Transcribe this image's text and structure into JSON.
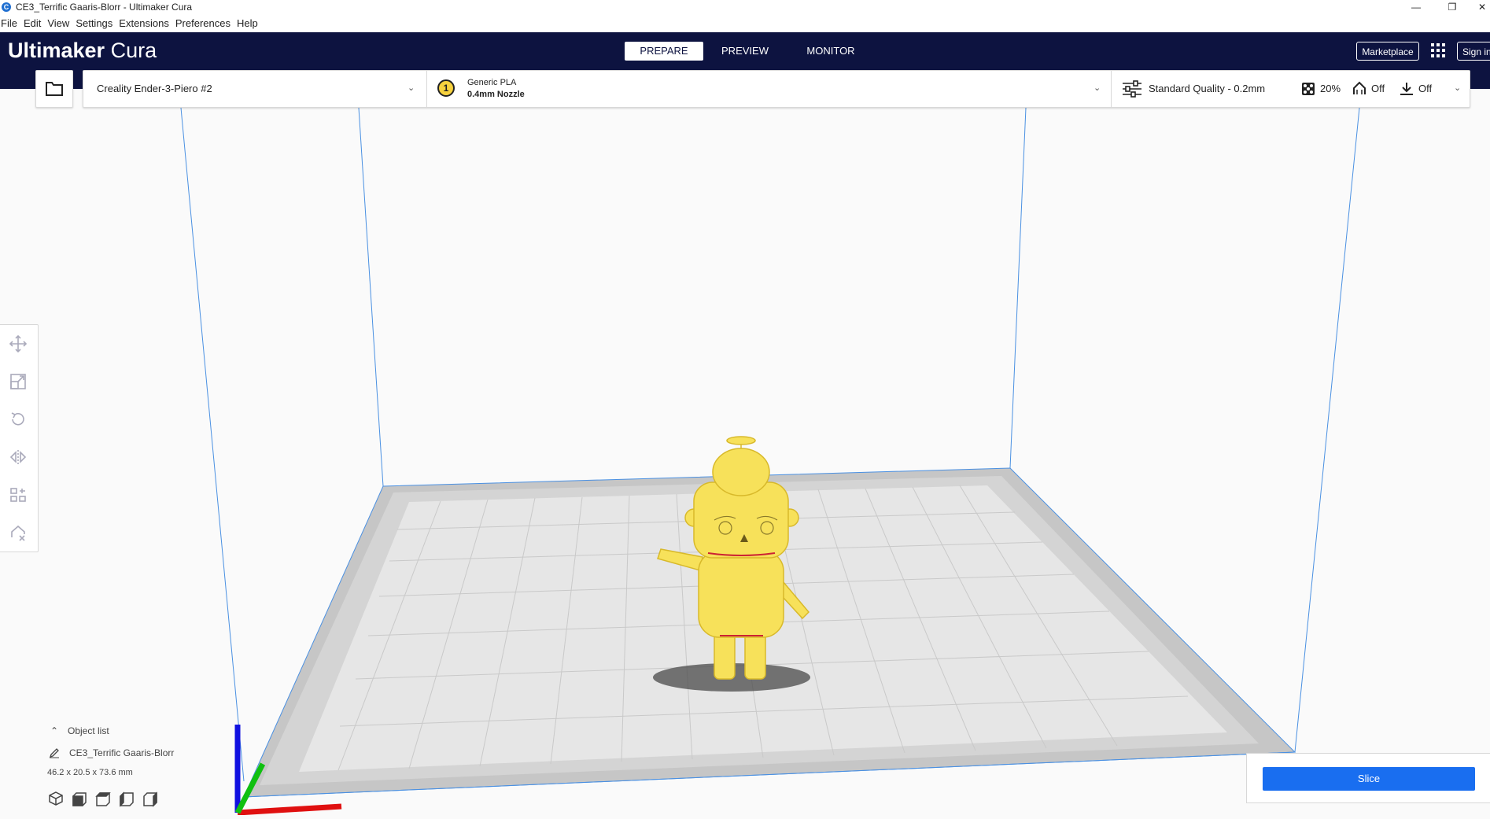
{
  "window": {
    "title": "CE3_Terrific Gaaris-Blorr - Ultimaker Cura",
    "app_icon_letter": "C",
    "minimize_icon": "minimize-icon",
    "restore_icon": "restore-icon",
    "close_icon": "close-icon"
  },
  "menu": [
    "File",
    "Edit",
    "View",
    "Settings",
    "Extensions",
    "Preferences",
    "Help"
  ],
  "header": {
    "brand_bold": "Ultimaker",
    "brand_light": "Cura",
    "tabs": [
      {
        "label": "PREPARE",
        "active": true
      },
      {
        "label": "PREVIEW",
        "active": false
      },
      {
        "label": "MONITOR",
        "active": false
      }
    ],
    "marketplace_label": "Marketplace",
    "signin_label": "Sign in",
    "accent_color": "#0d1340"
  },
  "toolbar": {
    "open_icon": "folder-icon",
    "printer_name": "Creality Ender-3-Piero #2",
    "extruder_number": "1",
    "material": "Generic PLA",
    "nozzle": "0.4mm Nozzle",
    "quality": "Standard Quality - 0.2mm",
    "infill": "20%",
    "support": "Off",
    "adhesion": "Off"
  },
  "left_tools": [
    {
      "name": "move-tool",
      "icon": "move-icon"
    },
    {
      "name": "scale-tool",
      "icon": "scale-icon"
    },
    {
      "name": "rotate-tool",
      "icon": "rotate-icon"
    },
    {
      "name": "mirror-tool",
      "icon": "mirror-icon"
    },
    {
      "name": "per-model-settings-tool",
      "icon": "per-model-settings-icon"
    },
    {
      "name": "support-blocker-tool",
      "icon": "support-blocker-icon"
    }
  ],
  "object_panel": {
    "list_label": "Object list",
    "object_name": "CE3_Terrific Gaaris-Blorr",
    "dimensions": "46.2 x 20.5 x 73.6 mm"
  },
  "view_buttons": [
    "3d-view",
    "front-view",
    "top-view",
    "left-view",
    "right-view"
  ],
  "slice": {
    "button_label": "Slice",
    "button_color": "#196ef0"
  },
  "scene": {
    "model_color": "#f7e15a",
    "build_plate_color": "#c8c8c8",
    "volume_edge_color": "#4a90e2"
  }
}
